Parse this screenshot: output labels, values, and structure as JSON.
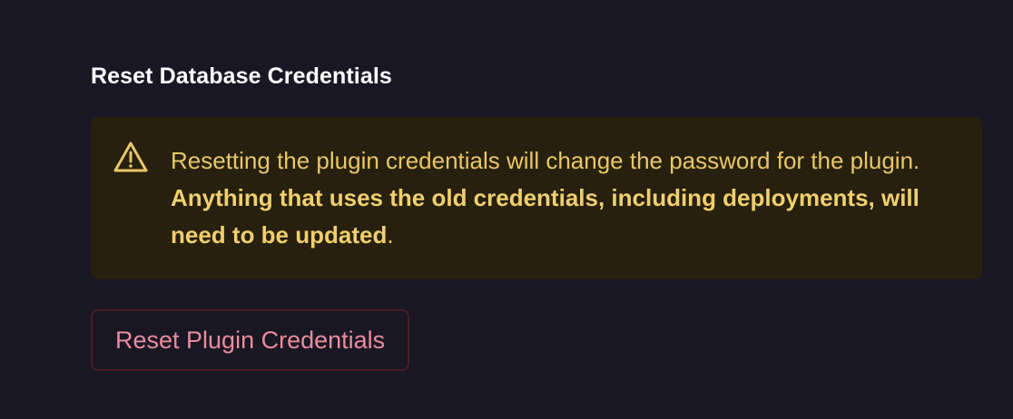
{
  "section": {
    "title": "Reset Database Credentials"
  },
  "warning": {
    "icon": "warning-triangle-icon",
    "text_intro": "Resetting the plugin credentials will change the password for the plugin. ",
    "text_emphasis": "Anything that uses the old credentials, including deployments, will need to be updated",
    "text_end": ".",
    "colors": {
      "background": "#27200f",
      "text": "#e8c766"
    }
  },
  "actions": {
    "reset_button_label": "Reset Plugin Credentials",
    "reset_button_color": "#e98c9b",
    "reset_button_border": "#4a1d25"
  },
  "theme": {
    "background": "#191724",
    "title_color": "#ffffff"
  }
}
